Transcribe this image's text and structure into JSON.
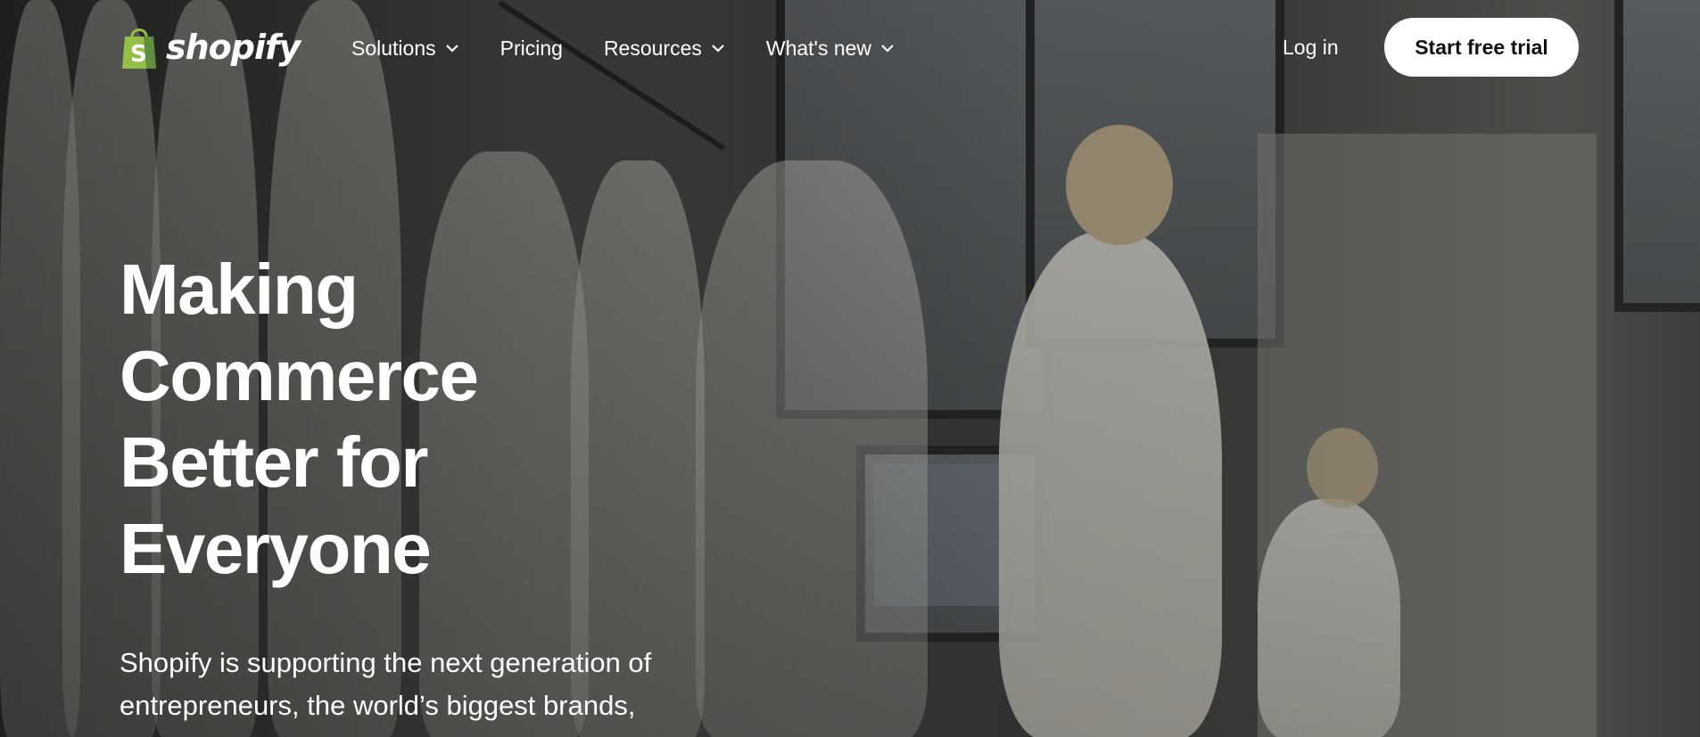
{
  "brand": {
    "name": "shopify",
    "accent_color": "#95bf47"
  },
  "nav": {
    "items": [
      {
        "label": "Solutions",
        "has_dropdown": true
      },
      {
        "label": "Pricing",
        "has_dropdown": false
      },
      {
        "label": "Resources",
        "has_dropdown": true
      },
      {
        "label": "What's new",
        "has_dropdown": true
      }
    ],
    "login_label": "Log in",
    "cta_label": "Start free trial"
  },
  "hero": {
    "headline_lines": [
      "Making",
      "Commerce",
      "Better for",
      "Everyone"
    ],
    "subcopy_lines": [
      "Shopify is supporting the next generation of",
      "entrepreneurs, the world’s biggest brands,"
    ]
  }
}
